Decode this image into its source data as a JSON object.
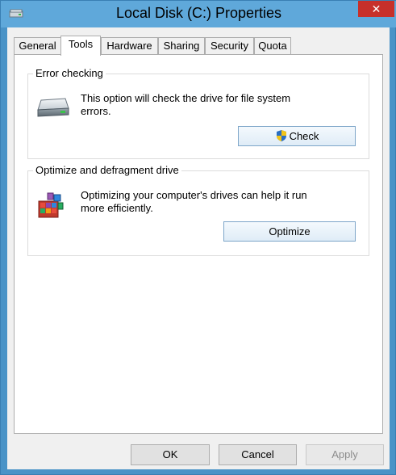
{
  "window": {
    "title": "Local Disk (C:) Properties",
    "close_label": "✕"
  },
  "tabs": [
    {
      "label": "General"
    },
    {
      "label": "Tools"
    },
    {
      "label": "Hardware"
    },
    {
      "label": "Sharing"
    },
    {
      "label": "Security"
    },
    {
      "label": "Quota"
    }
  ],
  "active_tab": "Tools",
  "error_checking": {
    "title": "Error checking",
    "description": "This option will check the drive for file system errors.",
    "button_label": "Check",
    "icon": "hard-drive-icon"
  },
  "optimize": {
    "title": "Optimize and defragment drive",
    "description": "Optimizing your computer's drives can help it run more efficiently.",
    "button_label": "Optimize",
    "icon": "defrag-icon"
  },
  "footer": {
    "ok_label": "OK",
    "cancel_label": "Cancel",
    "apply_label": "Apply"
  },
  "colors": {
    "title_bar": "#5fa8da",
    "close_button": "#c7302a",
    "accent_button_border": "#7ea6c9"
  }
}
